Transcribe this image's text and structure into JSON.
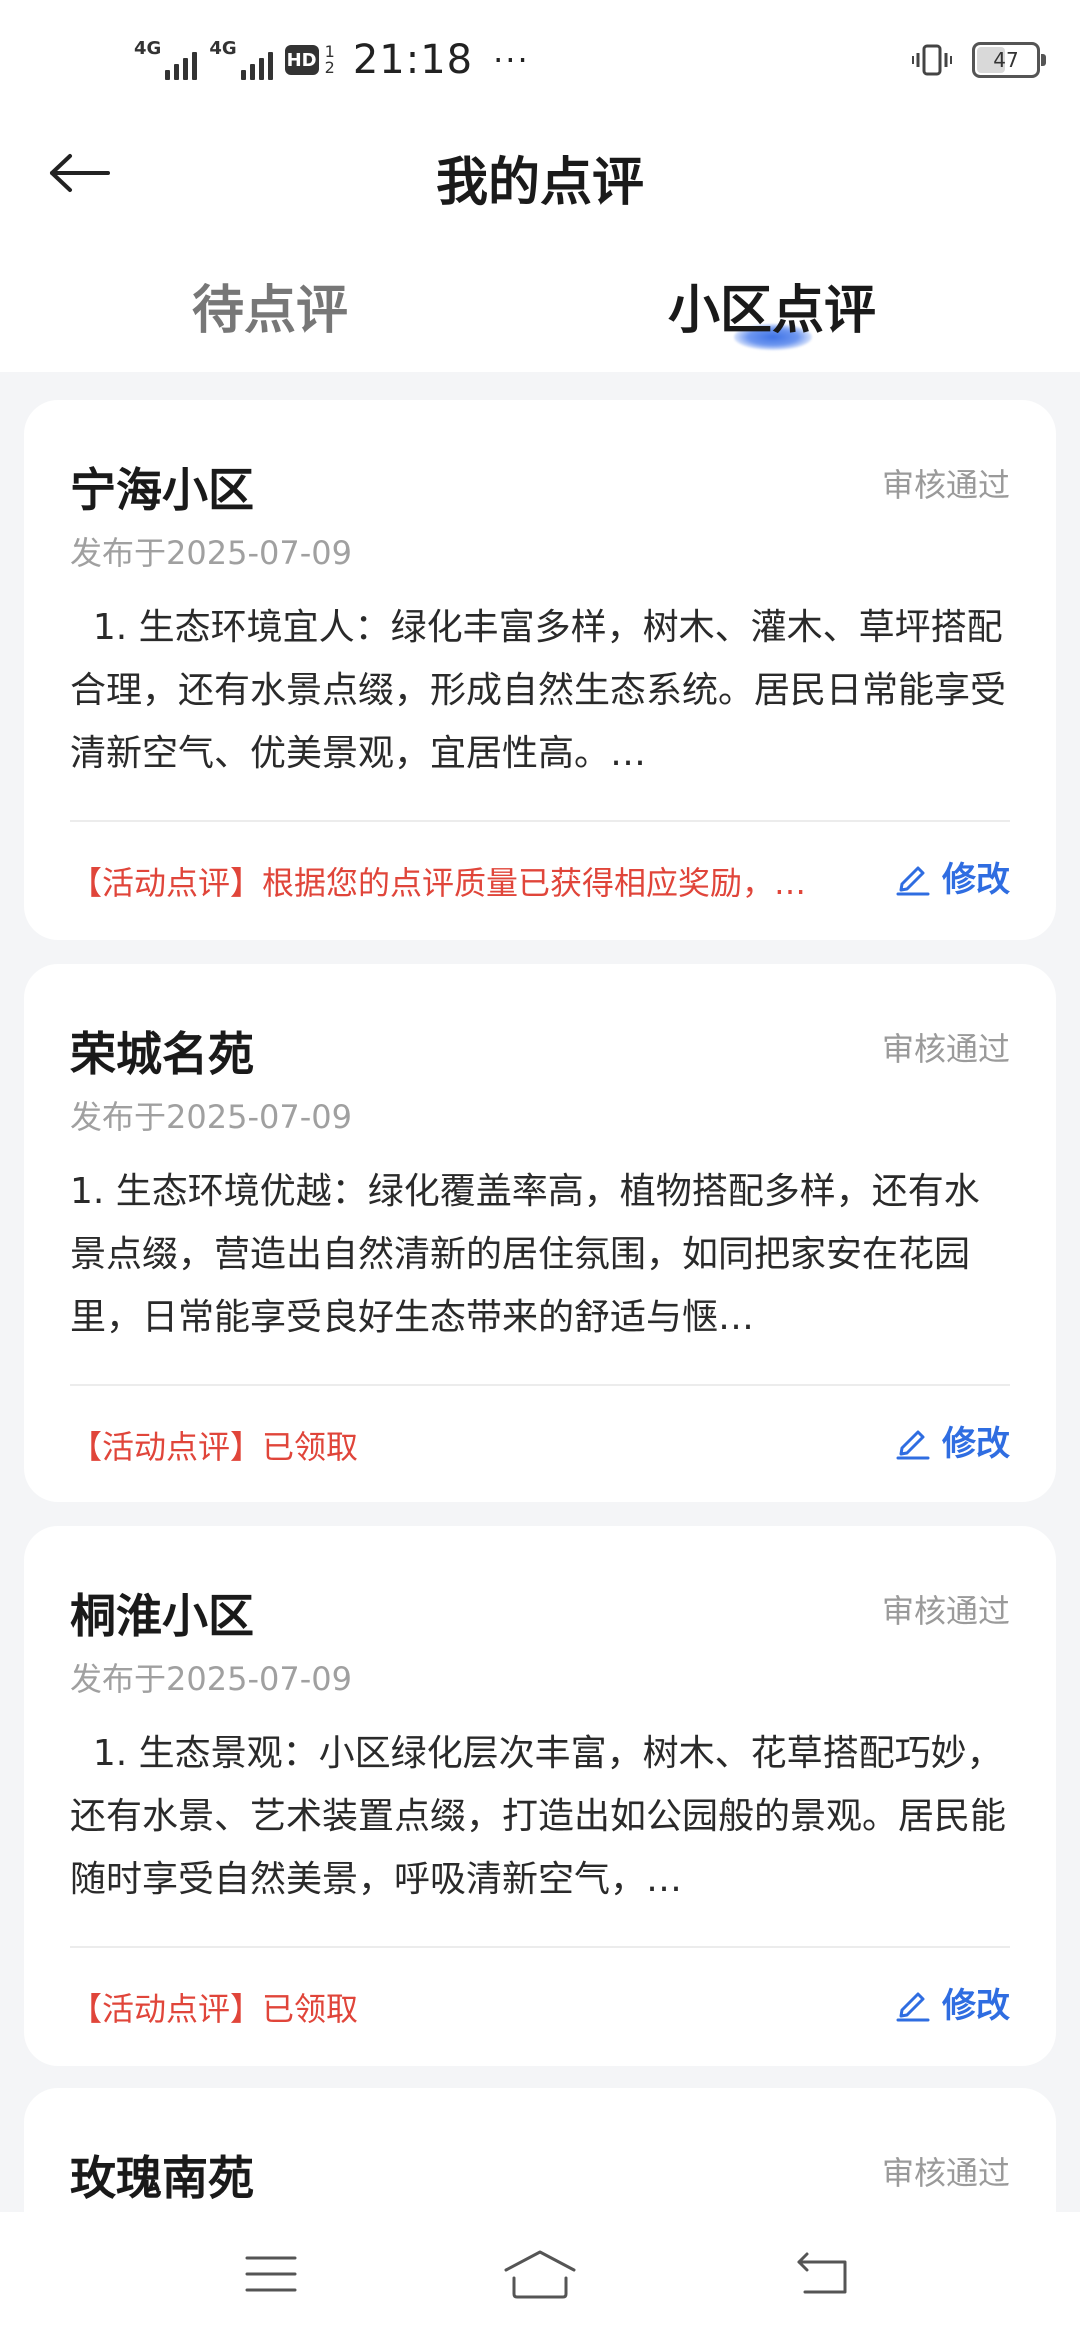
{
  "status_bar": {
    "network1": "4G",
    "network2": "4G",
    "hd_label": "HD",
    "hd_sub_top": "1",
    "hd_sub_bottom": "2",
    "time": "21:18",
    "more": "···",
    "battery": "47"
  },
  "header": {
    "title": "我的点评"
  },
  "tabs": {
    "pending_label": "待点评",
    "community_label": "小区点评",
    "active": "community"
  },
  "reviews": [
    {
      "name": "宁海小区",
      "status": "审核通过",
      "date": "发布于2025-07-09",
      "body": "  1. 生态环境宜人：绿化丰富多样，树木、灌木、草坪搭配合理，还有水景点缀，形成自然生态系统。居民日常能享受清新空气、优美景观，宜居性高。…",
      "activity": "【活动点评】根据您的点评质量已获得相应奖励，…",
      "edit_label": "修改"
    },
    {
      "name": "荣城名苑",
      "status": "审核通过",
      "date": "发布于2025-07-09",
      "body": "1. 生态环境优越：绿化覆盖率高，植物搭配多样，还有水景点缀，营造出自然清新的居住氛围，如同把家安在花园里，日常能享受良好生态带来的舒适与惬…",
      "activity": "【活动点评】已领取",
      "edit_label": "修改"
    },
    {
      "name": "桐淮小区",
      "status": "审核通过",
      "date": "发布于2025-07-09",
      "body": "  1. 生态景观：小区绿化层次丰富，树木、花草搭配巧妙，还有水景、艺术装置点缀，打造出如公园般的景观。居民能随时享受自然美景，呼吸清新空气，…",
      "activity": "【活动点评】已领取",
      "edit_label": "修改"
    },
    {
      "name": "玫瑰南苑",
      "status": "审核通过"
    }
  ],
  "colors": {
    "accent_blue": "#2f6de1",
    "activity_red": "#e0453a",
    "background": "#f4f5f7"
  },
  "icons": {
    "back": "arrow-left-icon",
    "edit": "pencil-icon",
    "menu": "menu-icon",
    "home": "home-icon",
    "back_nav": "return-icon"
  }
}
